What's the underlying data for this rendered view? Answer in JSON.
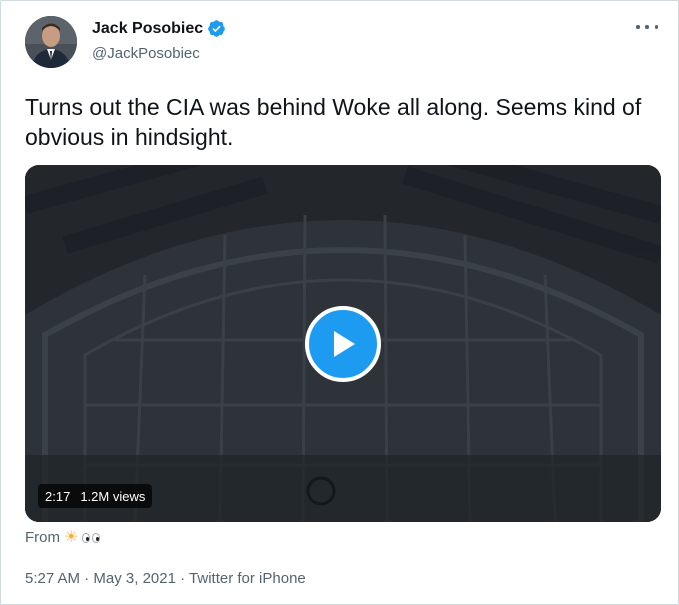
{
  "tweet": {
    "author_name": "Jack Posobiec",
    "author_handle": "@JackPosobiec",
    "verified_icon": "verified-badge-icon",
    "text": "Turns out the CIA was behind Woke all along. Seems kind of obvious in hindsight.",
    "video": {
      "duration": "2:17",
      "views": "1.2M views",
      "play_icon": "play-icon"
    },
    "source_label": "From",
    "source_emoji": "☀",
    "time": "5:27 AM",
    "date": "May 3, 2021",
    "client": "Twitter for iPhone",
    "sep": "·"
  },
  "colors": {
    "accent": "#1d9bf0",
    "text_primary": "#0f1419",
    "text_secondary": "#536471"
  }
}
